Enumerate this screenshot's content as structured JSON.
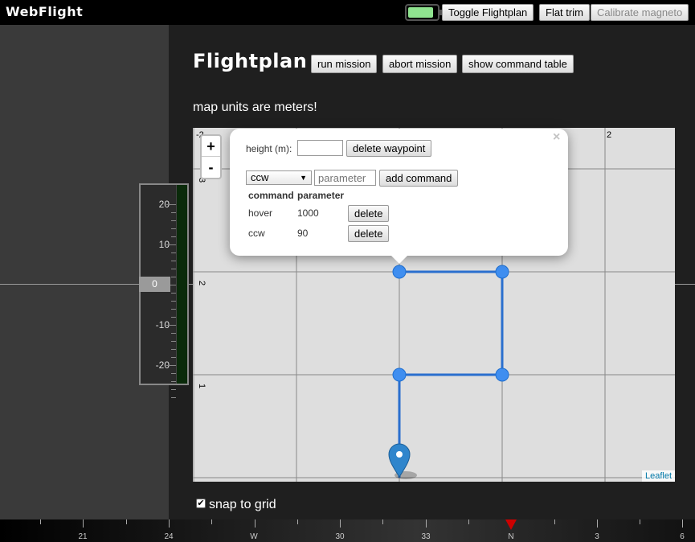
{
  "app": {
    "brand": "WebFlight",
    "battery_level": 0.88,
    "battery_color": "#8fe38f"
  },
  "toolbar": {
    "toggle_flightplan": "Toggle Flightplan",
    "flat_trim": "Flat trim",
    "calibrate_magneto": "Calibrate magneto"
  },
  "hud": {
    "altitude_labels": [
      "20",
      "10",
      "0",
      "-10",
      "-20"
    ],
    "altitude_readout": "0"
  },
  "flightplan": {
    "title": "Flightplan",
    "run_mission": "run mission",
    "abort_mission": "abort mission",
    "show_command_table": "show command table",
    "map_units_note": "map units are meters!",
    "snap_to_grid": "snap to grid",
    "snap_checked": true
  },
  "map": {
    "grid_labels": [
      "-2",
      "2",
      "3",
      "2",
      "1"
    ],
    "zoom_in": "+",
    "zoom_out": "-",
    "attribution": "Leaflet",
    "route_color": "#2a6fce",
    "waypoints": [
      [
        0,
        0
      ],
      [
        0,
        1
      ],
      [
        1,
        1
      ],
      [
        1,
        2
      ],
      [
        0,
        2
      ]
    ]
  },
  "popup": {
    "close": "×",
    "height_label": "height (m):",
    "height_value": "",
    "delete_waypoint": "delete waypoint",
    "command_selected": "ccw",
    "parameter_placeholder": "parameter",
    "add_command": "add command",
    "table_headers": [
      "command",
      "parameter"
    ],
    "commands": [
      {
        "command": "hover",
        "parameter": "1000",
        "delete": "delete"
      },
      {
        "command": "ccw",
        "parameter": "90",
        "delete": "delete"
      }
    ]
  },
  "compass": {
    "labels": [
      "21",
      "24",
      "W",
      "30",
      "33",
      "N",
      "3",
      "6"
    ],
    "heading_marker_color": "#cc0000"
  }
}
